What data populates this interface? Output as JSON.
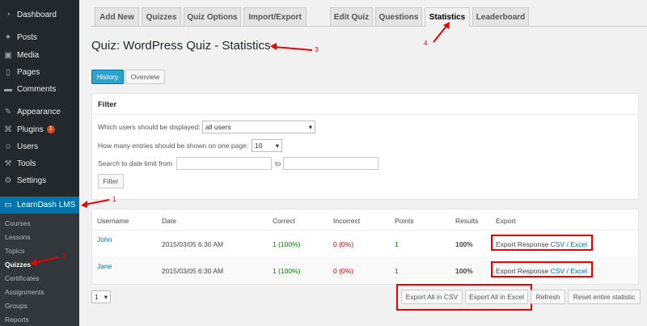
{
  "sidebar": {
    "items": [
      {
        "label": "Dashboard",
        "icon": "dashboard-icon",
        "glyph": "◔"
      },
      {
        "label": "Posts",
        "icon": "pin-icon",
        "glyph": "✦"
      },
      {
        "label": "Media",
        "icon": "media-icon",
        "glyph": "▣"
      },
      {
        "label": "Pages",
        "icon": "pages-icon",
        "glyph": "▯"
      },
      {
        "label": "Comments",
        "icon": "comment-icon",
        "glyph": "▬"
      },
      {
        "label": "Appearance",
        "icon": "brush-icon",
        "glyph": "✎"
      },
      {
        "label": "Plugins",
        "icon": "plug-icon",
        "glyph": "⌘",
        "badge": "1"
      },
      {
        "label": "Users",
        "icon": "user-icon",
        "glyph": "☺"
      },
      {
        "label": "Tools",
        "icon": "wrench-icon",
        "glyph": "⚒"
      },
      {
        "label": "Settings",
        "icon": "settings-icon",
        "glyph": "⚙"
      },
      {
        "label": "LearnDash LMS",
        "icon": "learndash-icon",
        "glyph": "▭"
      }
    ],
    "submenu": [
      "Courses",
      "Lessons",
      "Topics",
      "Quizzes",
      "Certificates",
      "Assignments",
      "Groups",
      "Reports"
    ]
  },
  "tabs": [
    "Add New",
    "Quizzes",
    "Quiz Options",
    "Import/Export",
    "Edit Quiz",
    "Questions",
    "Statistics",
    "Leaderboard"
  ],
  "page_title": "Quiz: WordPress Quiz - Statistics",
  "view_buttons": {
    "history": "History",
    "overview": "Overview"
  },
  "filter": {
    "title": "Filter",
    "users_label": "Which users should be displayed:",
    "users_value": "all users",
    "entries_label": "How many entries should be shown on one page:",
    "entries_value": "10",
    "date_from_label": "Search to date limit from",
    "date_to_label": "to",
    "button": "Filter"
  },
  "table": {
    "headers": [
      "Username",
      "Date",
      "Correct",
      "Incorrect",
      "Points",
      "Results",
      "Export"
    ],
    "rows": [
      {
        "username": "John",
        "date": "2015/03/05 6:30 AM",
        "correct": "1 (100%)",
        "incorrect": "0 (0%)",
        "points": "1",
        "results": "100%",
        "export_prefix": "Export Response",
        "csv": "CSV",
        "sep": "/",
        "excel": "Excel"
      },
      {
        "username": "Jane",
        "date": "2015/03/05 6:30 AM",
        "correct": "1 (100%)",
        "incorrect": "0 (0%)",
        "points": "1",
        "results": "100%",
        "export_prefix": "Export Response",
        "csv": "CSV",
        "sep": "/",
        "excel": "Excel"
      }
    ]
  },
  "pagination": {
    "value": "1"
  },
  "actions": {
    "export_csv": "Export All in CSV",
    "export_excel": "Export All in Excel",
    "refresh": "Refresh",
    "reset": "Reset entire statistic"
  },
  "annotations": [
    "1",
    "2",
    "3",
    "4"
  ],
  "colors": {
    "annotation": "#e00000",
    "accent": "#0073aa",
    "sidebar": "#23282d"
  }
}
